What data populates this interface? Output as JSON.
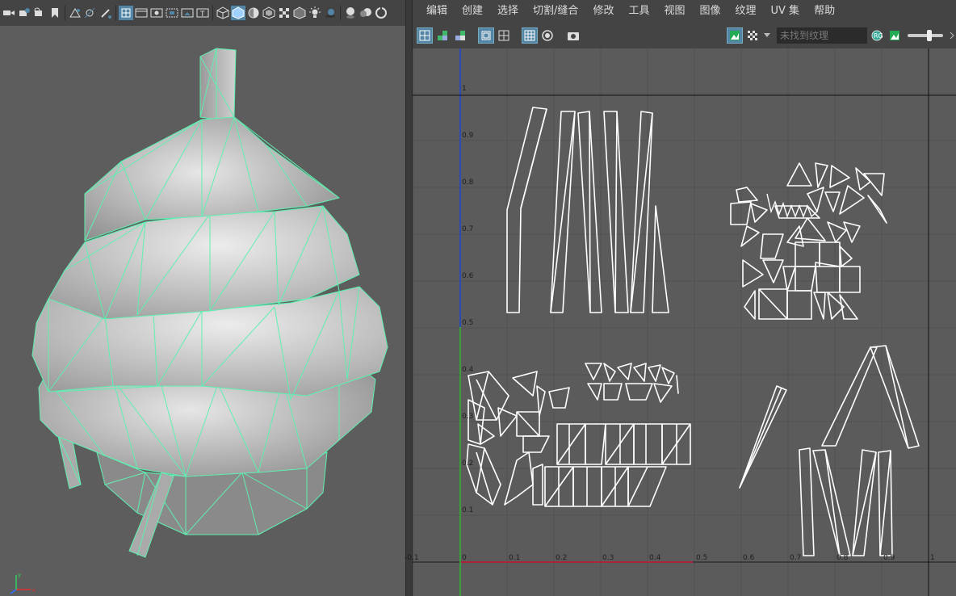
{
  "viewport": {
    "toolbar_icons": [
      "camera-icon",
      "camera-attr-icon",
      "bookmark-icon",
      "image-plane-icon",
      "grid-icon",
      "film-gate-icon",
      "resolution-gate-icon",
      "gate-mask-icon",
      "field-chart-icon",
      "safe-action-icon",
      "safe-title-icon",
      "wireframe-icon",
      "smooth-shade-icon",
      "default-material-icon",
      "textured-icon",
      "use-lights-icon",
      "shadows-icon",
      "ambient-occlusion-icon",
      "motion-blur-icon",
      "anti-alias-icon"
    ]
  },
  "menu": [
    "编辑",
    "创建",
    "选择",
    "切割/缝合",
    "修改",
    "工具",
    "视图",
    "图像",
    "纹理",
    "UV 集",
    "帮助"
  ],
  "uv_toolbar": {
    "texture_placeholder": "未找到纹理"
  },
  "uv_axis": {
    "x_ticks": [
      "-0.1",
      "0",
      "0.1",
      "0.2",
      "0.3",
      "0.4",
      "0.5",
      "0.6",
      "0.7",
      "0.8",
      "0.9",
      "1"
    ],
    "y_ticks": [
      "1",
      "0.9",
      "0.8",
      "0.7",
      "0.6",
      "0.5",
      "0.4",
      "0.3",
      "0.2",
      "0.1"
    ]
  },
  "colors": {
    "wire": "#5ef0b0",
    "mesh": "#b8b8b8",
    "u_axis": "#c8102e",
    "v_axis": "#1e46d2",
    "v_axis_lower": "#2fb52f"
  }
}
